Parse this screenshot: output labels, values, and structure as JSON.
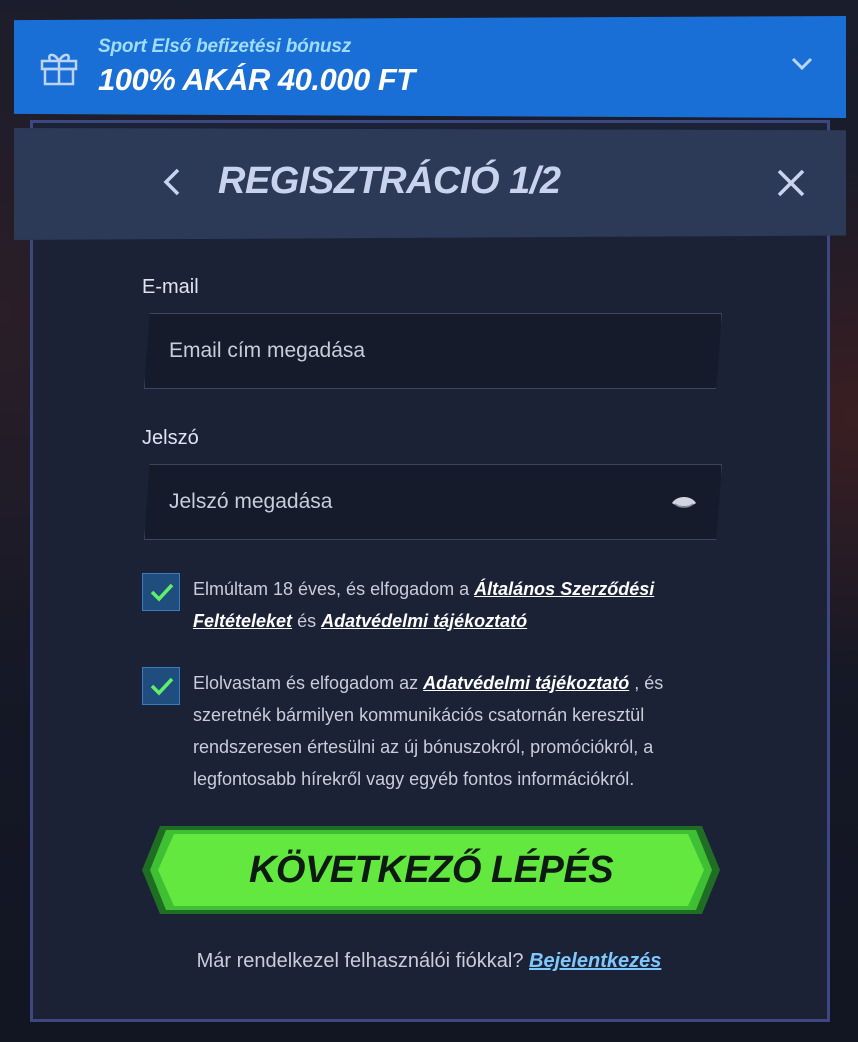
{
  "bonus": {
    "subtitle": "Sport Első befizetési bónusz",
    "title": "100% AKÁR 40.000 FT",
    "icon": "gift-icon",
    "expand_icon": "chevron-down-icon"
  },
  "header": {
    "title": "REGISZTRÁCIÓ 1/2",
    "back_icon": "chevron-left-icon",
    "close_icon": "close-icon"
  },
  "form": {
    "email": {
      "label": "E-mail",
      "placeholder": "Email cím megadása",
      "value": ""
    },
    "password": {
      "label": "Jelszó",
      "placeholder": "Jelszó megadása",
      "value": "",
      "toggle_icon": "eye-icon"
    },
    "consent_terms": {
      "checked": true,
      "text_before": "Elmúltam 18 éves, és elfogadom a",
      "link1": "Általános Szerződési Feltételeket",
      "text_middle": "és",
      "link2": "Adatvédelmi tájékoztató"
    },
    "consent_marketing": {
      "checked": true,
      "text_before": "Elolvastam és elfogadom az",
      "link": "Adatvédelmi tájékoztató",
      "text_after": ", és szeretnék bármilyen kommunikációs csatornán keresztül rendszeresen értesülni az új bónuszokról, promóciókról, a legfontosabb hírekről vagy egyéb fontos információkról."
    },
    "submit_label": "KÖVETKEZŐ LÉPÉS"
  },
  "footer": {
    "question": "Már rendelkezel felhasználói fiókkal?",
    "login_link": "Bejelentkezés"
  },
  "colors": {
    "accent_blue": "#1a6fd6",
    "cta_green": "#62e83f",
    "modal_bg": "#1b2236",
    "header_bg": "#2c3a57",
    "link_blue": "#7fc8ff"
  }
}
